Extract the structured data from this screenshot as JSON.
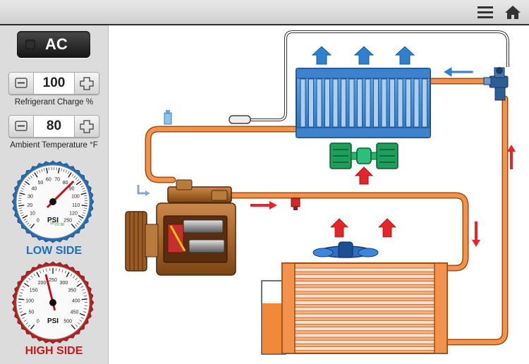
{
  "toolbar": {
    "menu_icon": "hamburger-menu-icon",
    "home_icon": "home-icon"
  },
  "sidebar": {
    "ac_button": {
      "label": "AC"
    },
    "refrigerant_charge": {
      "value": "100",
      "label": "Refrigerant Charge %"
    },
    "ambient_temperature": {
      "value": "80",
      "label": "Ambient Temperature °F"
    },
    "low_side_gauge": {
      "title": "LOW SIDE",
      "unit": "PSI",
      "ticks": [
        "0",
        "10",
        "20",
        "30",
        "40",
        "50",
        "60",
        "70",
        "80",
        "90",
        "100",
        "110",
        "120",
        "250"
      ],
      "vacuum_ticks": [
        "10",
        "20",
        "30"
      ],
      "reading": 86,
      "color": "#1a6fc0"
    },
    "high_side_gauge": {
      "title": "HIGH SIDE",
      "unit": "PSI",
      "ticks": [
        "0",
        "50",
        "100",
        "150",
        "200",
        "250",
        "300",
        "350",
        "400",
        "450",
        "500"
      ],
      "reading": 225,
      "color": "#c01a1a"
    }
  },
  "diagram": {
    "components": [
      "evaporator",
      "expansion-valve",
      "blower-motor",
      "compressor",
      "condenser",
      "condenser-fan",
      "receiver-drier"
    ],
    "colors": {
      "pipe": "#f08a3a",
      "pipe_outline": "#9c4d12",
      "evaporator": "#4a8fd6",
      "hot_arrow": "#e0262a",
      "cool_arrow": "#1d7cd3"
    }
  }
}
